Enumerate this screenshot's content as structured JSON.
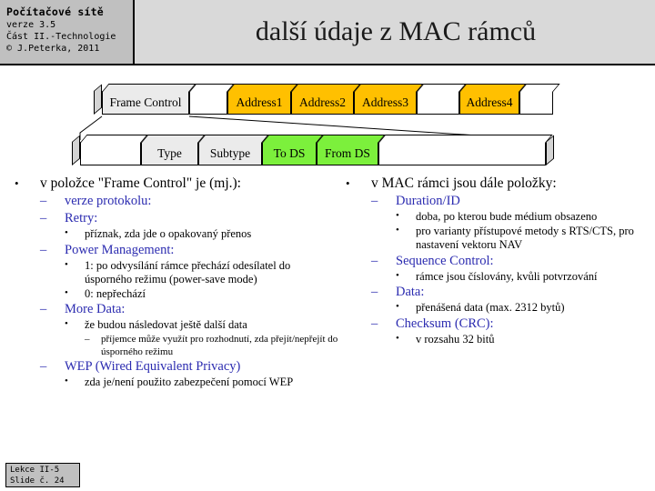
{
  "header": {
    "course": "Počítačové sítě",
    "version": "verze 3.5",
    "part": "Část II.-Technologie",
    "copyright": "© J.Peterka, 2011",
    "title": "další údaje z MAC rámců"
  },
  "colors": {
    "header_background": "#d9d9d9",
    "id_box_background": "#c0c0c0",
    "address_cell": "#ffc000",
    "ds_cell": "#7cf03c",
    "neutral_cell": "#ebebeb",
    "level2_text": "#2b2bb0"
  },
  "diagram": {
    "top_bar": [
      {
        "label": "Frame Control",
        "style": "gray"
      },
      {
        "label": "",
        "style": "white"
      },
      {
        "label": "Address1",
        "style": "orange"
      },
      {
        "label": "Address2",
        "style": "orange"
      },
      {
        "label": "Address3",
        "style": "orange"
      },
      {
        "label": "",
        "style": "white"
      },
      {
        "label": "Address4",
        "style": "orange"
      },
      {
        "label": "",
        "style": "white"
      }
    ],
    "bottom_bar": [
      {
        "label": "",
        "style": "white"
      },
      {
        "label": "Type",
        "style": "gray"
      },
      {
        "label": "Subtype",
        "style": "gray"
      },
      {
        "label": "To DS",
        "style": "green"
      },
      {
        "label": "From DS",
        "style": "green"
      },
      {
        "label": "",
        "style": "white"
      }
    ]
  },
  "left_column": {
    "heading": "v položce \"Frame Control\" je (mj.):",
    "items": [
      {
        "label": "verze protokolu:",
        "children": []
      },
      {
        "label": "Retry:",
        "children": [
          {
            "text": "příznak,  zda jde o opakovaný  přenos"
          }
        ]
      },
      {
        "label": "Power Management:",
        "children": [
          {
            "text": "1: po odvysílání  rámce  přechází  odesílatel  do úsporného  režimu  (power-save mode)"
          },
          {
            "text": "0: nepřechází"
          }
        ]
      },
      {
        "label": "More Data:",
        "children": [
          {
            "text": "že budou následovat  ještě další  data",
            "subitems": [
              {
                "text": "příjemce může využít pro rozhodnutí, zda přejít/nepřejít do úsporného režimu"
              }
            ]
          }
        ]
      },
      {
        "label": "WEP (Wired Equivalent  Privacy)",
        "children": [
          {
            "text": "zda je/není  použito zabezpečení pomocí WEP"
          }
        ]
      }
    ]
  },
  "right_column": {
    "heading": "v MAC rámci jsou dále položky:",
    "items": [
      {
        "label": "Duration/ID",
        "children": [
          {
            "text": "doba, po kterou bude médium obsazeno"
          },
          {
            "text": "pro varianty  přístupové  metody s RTS/CTS,  pro nastavení  vektoru NAV"
          }
        ]
      },
      {
        "label": "Sequence Control:",
        "children": [
          {
            "text": "rámce jsou číslovány,  kvůli potvrzování"
          }
        ]
      },
      {
        "label": "Data:",
        "children": [
          {
            "text": "přenášená  data (max.  2312 bytů)"
          }
        ]
      },
      {
        "label": "Checksum (CRC):",
        "children": [
          {
            "text": "v rozsahu  32 bitů"
          }
        ]
      }
    ]
  },
  "footer": {
    "lecture": "Lekce II-5",
    "slide": "Slide č. 24"
  },
  "bullets": {
    "level1": "•",
    "level2": "–",
    "level3": "•",
    "level4": "–"
  }
}
